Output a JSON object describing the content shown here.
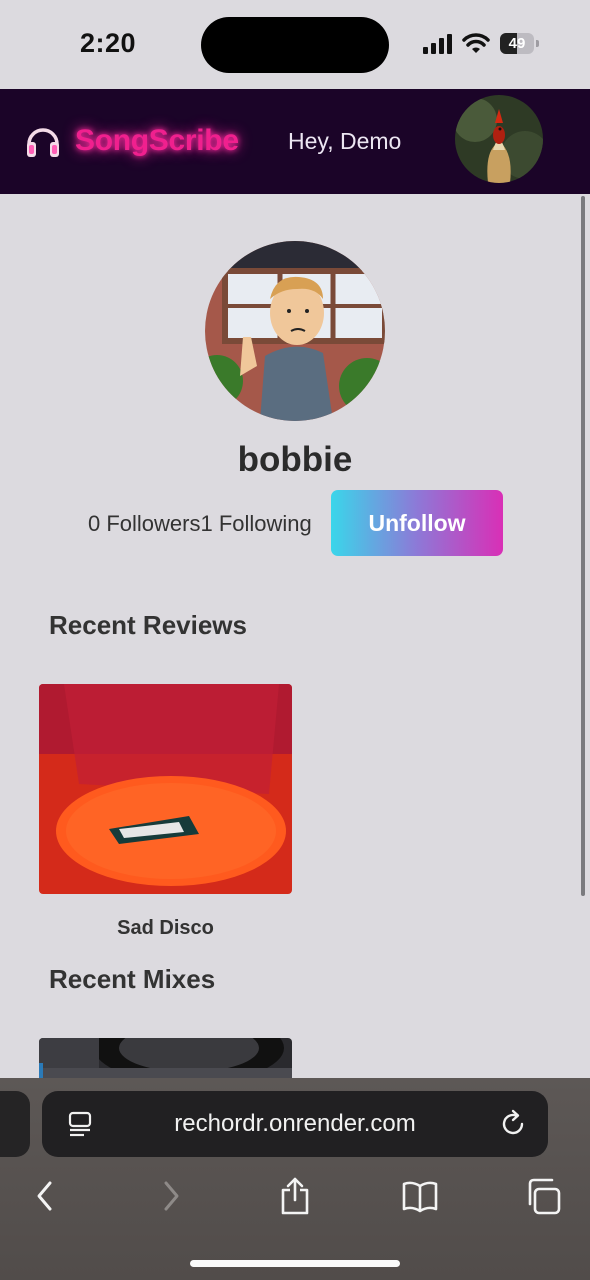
{
  "status_bar": {
    "time": "2:20",
    "battery": "49",
    "battery_level": 0.49
  },
  "header": {
    "brand": "SongScribe",
    "greeting": "Hey, Demo",
    "logo_icon": "headphones-icon",
    "avatar": "rooster-avatar"
  },
  "profile": {
    "username": "bobbie",
    "stats": "0 Followers1 Following",
    "unfollow_label": "Unfollow",
    "avatar": "cartoon-man-avatar"
  },
  "sections": {
    "reviews_title": "Recent Reviews",
    "mixes_title": "Recent Mixes"
  },
  "reviews": [
    {
      "title": "Sad Disco",
      "cover": "orange-painting-cover"
    }
  ],
  "mixes": [
    {
      "cover": "turntable-cover"
    }
  ],
  "browser": {
    "url": "rechordr.onrender.com",
    "icons": [
      "reader-icon",
      "reload-icon",
      "back-icon",
      "forward-icon",
      "share-icon",
      "bookmarks-icon",
      "tabs-icon"
    ]
  },
  "colors": {
    "brand": "#f0208e",
    "header_bg": "#1b0428",
    "page_bg": "#dcdadf",
    "button_gradient": [
      "#3ad6ea",
      "#8d79d7",
      "#d92fb6"
    ]
  }
}
